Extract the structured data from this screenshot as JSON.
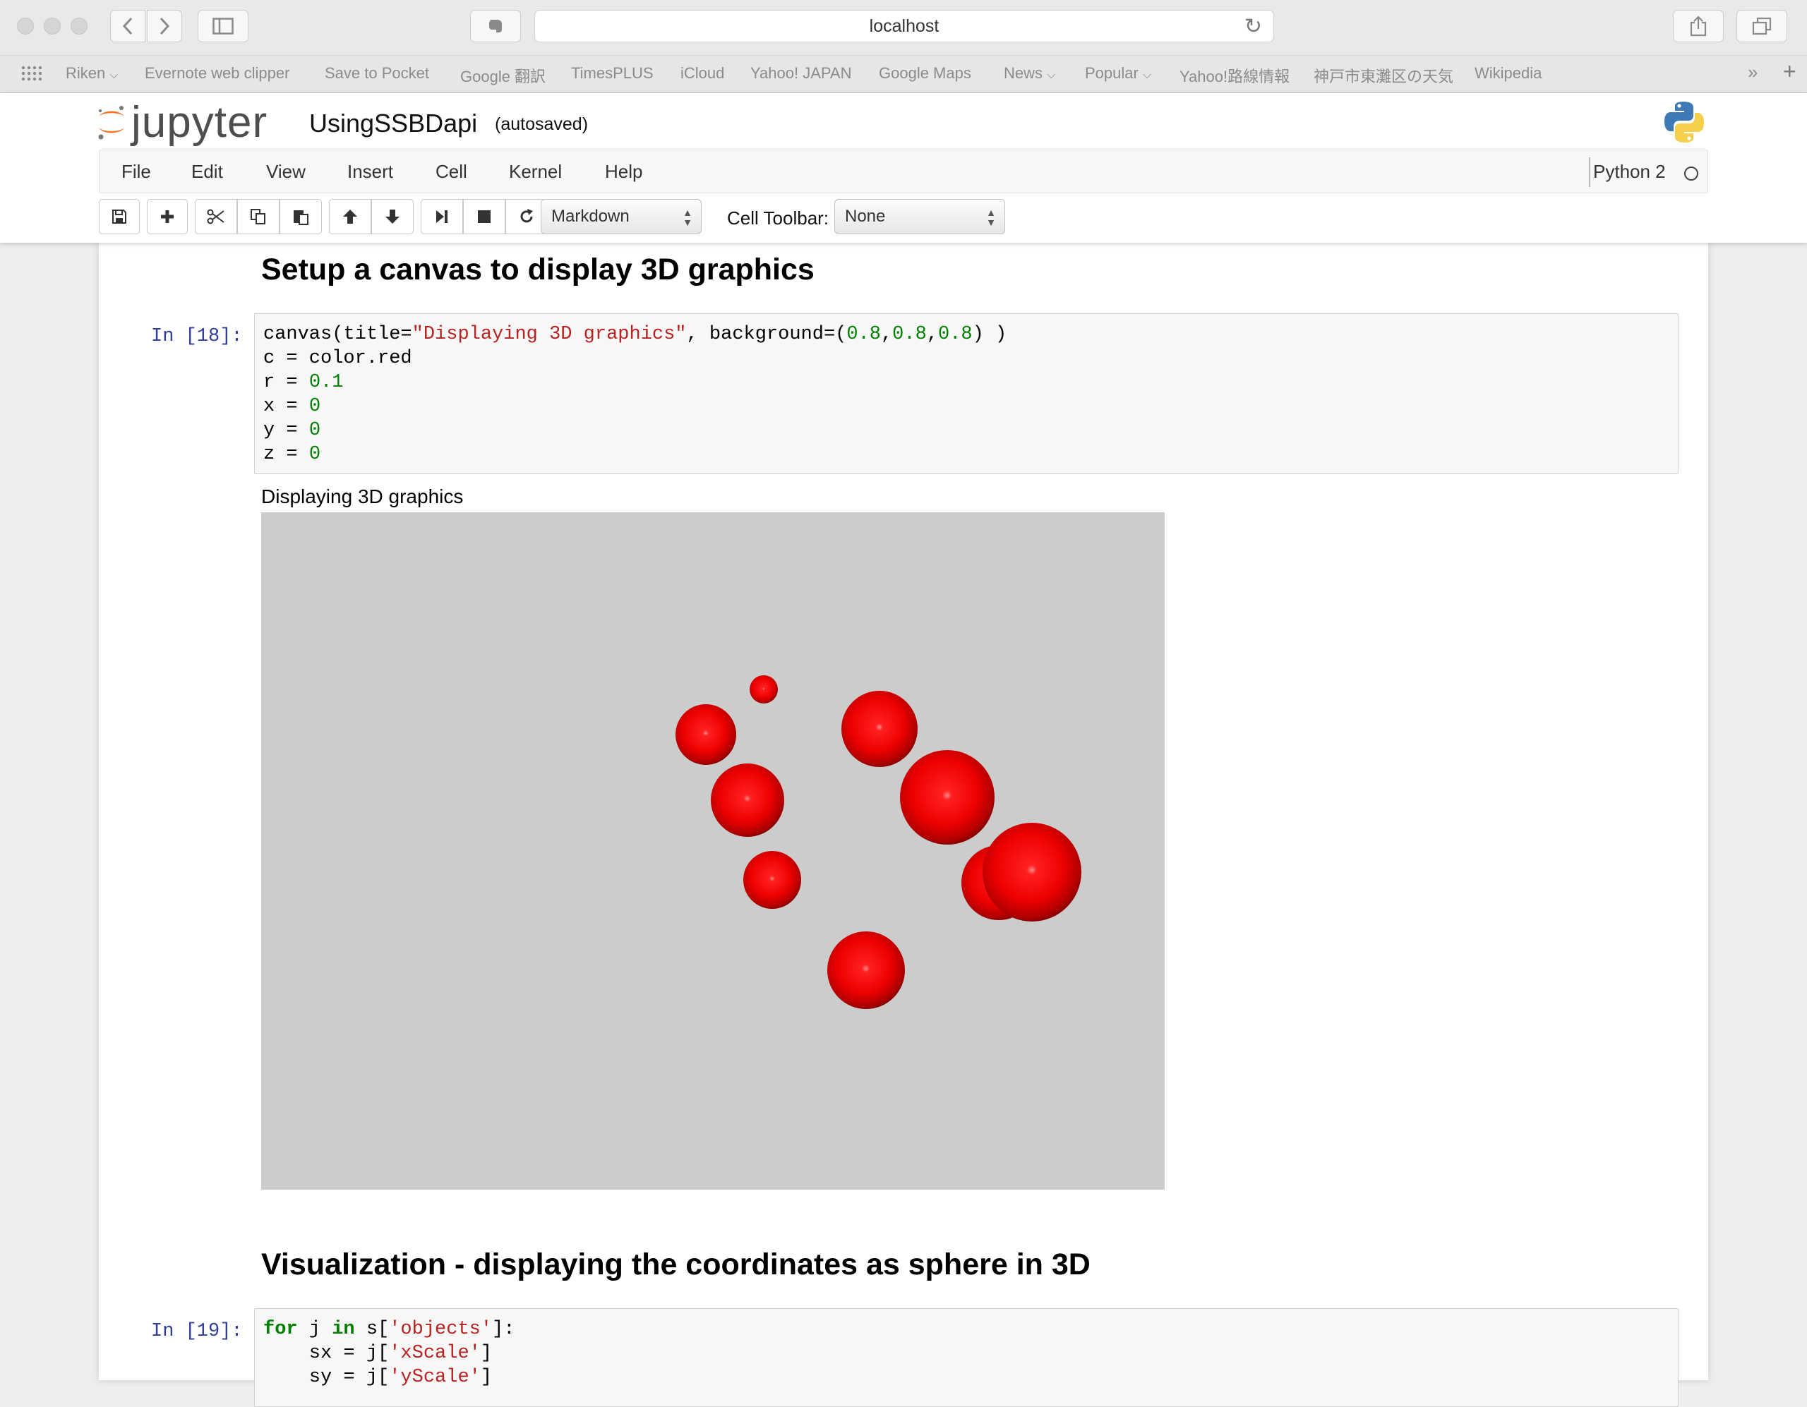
{
  "browser": {
    "url": "localhost",
    "bookmarks": [
      "Riken",
      "Evernote web clipper",
      "Save to Pocket",
      "Google 翻訳",
      "TimesPLUS",
      "iCloud",
      "Yahoo! JAPAN",
      "Google Maps",
      "News",
      "Popular",
      "Yahoo!路線情報",
      "神戸市東灘区の天気",
      "Wikipedia"
    ]
  },
  "jupyter": {
    "logo_text": "jupyter",
    "notebook_name": "UsingSSBDapi",
    "save_status": "(autosaved)",
    "menu": [
      "File",
      "Edit",
      "View",
      "Insert",
      "Cell",
      "Kernel",
      "Help"
    ],
    "kernel": "Python 2",
    "cell_type": "Markdown",
    "cell_toolbar_label": "Cell Toolbar:",
    "cell_toolbar_value": "None"
  },
  "cells": {
    "heading1": "Setup a canvas to display 3D graphics",
    "prompt18": "In [18]:",
    "prompt19": "In [19]:",
    "heading2": "Visualization - displaying the coordinates as sphere in 3D",
    "output_title": "Displaying 3D graphics"
  },
  "colors": {
    "canvas_background": "#cccccc",
    "sphere_color": "red",
    "prompt_color": "#303f9f"
  }
}
